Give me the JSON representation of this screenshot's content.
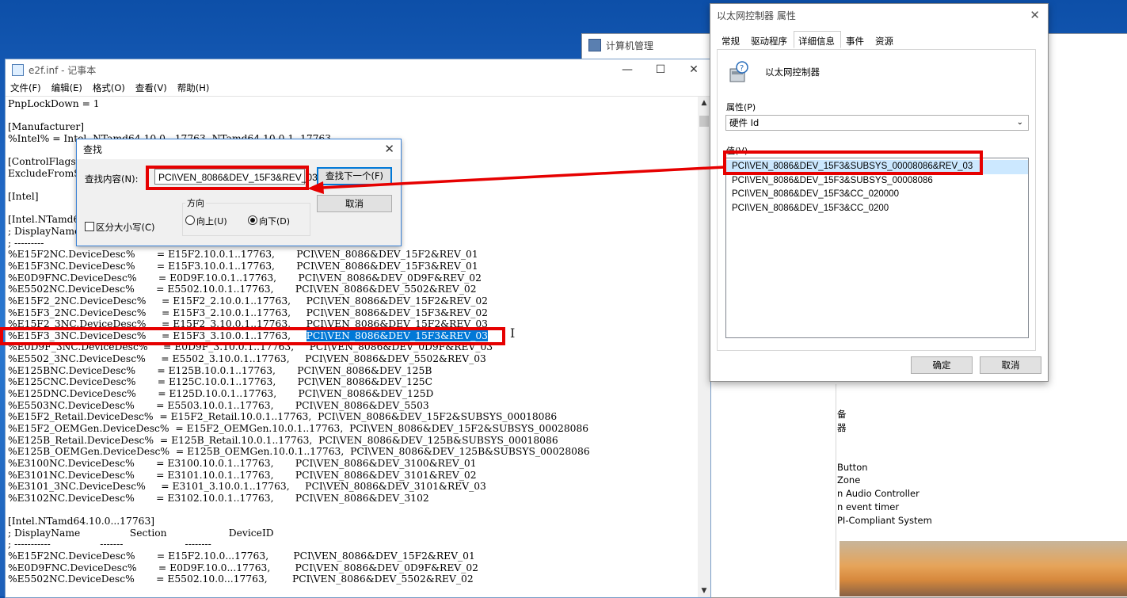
{
  "computer_management": {
    "title": "计算机管理",
    "tree_fragments": [
      "备",
      "器",
      "Button",
      "Zone",
      "n Audio Controller",
      "n event timer",
      "PI-Compliant System"
    ]
  },
  "notepad": {
    "title": "e2f.inf - 记事本",
    "window_controls": {
      "minimize": "—",
      "maximize": "☐",
      "close": "✕"
    },
    "menu": [
      "文件(F)",
      "编辑(E)",
      "格式(O)",
      "查看(V)",
      "帮助(H)"
    ],
    "lines": [
      "PnpLockDown = 1",
      "",
      "[Manufacturer]",
      "%Intel% = Intel, NTamd64.10.0...17763, NTamd64.10.0.1..17763",
      "",
      "[ControlFlags]",
      "ExcludeFromSelect = *",
      "",
      "[Intel]",
      "",
      "[Intel.NTamd64.10.0.1..17763]",
      "; DisplayName                Section                    DeviceID",
      "; ---------                  -------                    --------",
      "%E15F2NC.DeviceDesc%       = E15F2.10.0.1..17763,       PCI\\VEN_8086&DEV_15F2&REV_01",
      "%E15F3NC.DeviceDesc%       = E15F3.10.0.1..17763,       PCI\\VEN_8086&DEV_15F3&REV_01",
      "%E0D9FNC.DeviceDesc%       = E0D9F.10.0.1..17763,       PCI\\VEN_8086&DEV_0D9F&REV_02",
      "%E5502NC.DeviceDesc%       = E5502.10.0.1..17763,       PCI\\VEN_8086&DEV_5502&REV_02",
      "%E15F2_2NC.DeviceDesc%     = E15F2_2.10.0.1..17763,     PCI\\VEN_8086&DEV_15F2&REV_02",
      "%E15F3_2NC.DeviceDesc%     = E15F3_2.10.0.1..17763,     PCI\\VEN_8086&DEV_15F3&REV_02",
      "%E15F2_3NC.DeviceDesc%     = E15F2_3.10.0.1..17763,     PCI\\VEN_8086&DEV_15F2&REV_03",
      "%E15F3_3NC.DeviceDesc%     = E15F3_3.10.0.1..17763,     ",
      "%E0D9F_3NC.DeviceDesc%     = E0D9F_3.10.0.1..17763,     PCI\\VEN_8086&DEV_0D9F&REV_03",
      "%E5502_3NC.DeviceDesc%     = E5502_3.10.0.1..17763,     PCI\\VEN_8086&DEV_5502&REV_03",
      "%E125BNC.DeviceDesc%       = E125B.10.0.1..17763,       PCI\\VEN_8086&DEV_125B",
      "%E125CNC.DeviceDesc%       = E125C.10.0.1..17763,       PCI\\VEN_8086&DEV_125C",
      "%E125DNC.DeviceDesc%       = E125D.10.0.1..17763,       PCI\\VEN_8086&DEV_125D",
      "%E5503NC.DeviceDesc%       = E5503.10.0.1..17763,       PCI\\VEN_8086&DEV_5503",
      "%E15F2_Retail.DeviceDesc%  = E15F2_Retail.10.0.1..17763,  PCI\\VEN_8086&DEV_15F2&SUBSYS_00018086",
      "%E15F2_OEMGen.DeviceDesc%  = E15F2_OEMGen.10.0.1..17763,  PCI\\VEN_8086&DEV_15F2&SUBSYS_00028086",
      "%E125B_Retail.DeviceDesc%  = E125B_Retail.10.0.1..17763,  PCI\\VEN_8086&DEV_125B&SUBSYS_00018086",
      "%E125B_OEMGen.DeviceDesc%  = E125B_OEMGen.10.0.1..17763,  PCI\\VEN_8086&DEV_125B&SUBSYS_00028086",
      "%E3100NC.DeviceDesc%       = E3100.10.0.1..17763,       PCI\\VEN_8086&DEV_3100&REV_01",
      "%E3101NC.DeviceDesc%       = E3101.10.0.1..17763,       PCI\\VEN_8086&DEV_3101&REV_02",
      "%E3101_3NC.DeviceDesc%     = E3101_3.10.0.1..17763,     PCI\\VEN_8086&DEV_3101&REV_03",
      "%E3102NC.DeviceDesc%       = E3102.10.0.1..17763,       PCI\\VEN_8086&DEV_3102",
      "",
      "[Intel.NTamd64.10.0...17763]",
      "; DisplayName                Section                    DeviceID",
      "; -----------                -------                    --------",
      "%E15F2NC.DeviceDesc%       = E15F2.10.0...17763,        PCI\\VEN_8086&DEV_15F2&REV_01",
      "%E0D9FNC.DeviceDesc%       = E0D9F.10.0...17763,        PCI\\VEN_8086&DEV_0D9F&REV_02",
      "%E5502NC.DeviceDesc%       = E5502.10.0...17763,        PCI\\VEN_8086&DEV_5502&REV_02"
    ],
    "selected_match": "PCI\\VEN_8086&DEV_15F3&REV_03",
    "selected_line_index": 20,
    "scroll_up": "▲",
    "scroll_down": "▼"
  },
  "find_dialog": {
    "title": "查找",
    "close": "✕",
    "find_label": "查找内容(N):",
    "find_value": "PCI\\VEN_8086&DEV_15F3&REV_03",
    "find_next_button": "查找下一个(F)",
    "cancel_button": "取消",
    "direction_label": "方向",
    "up_label": "向上(U)",
    "down_label": "向下(D)",
    "direction_selected": "down",
    "match_case_label": "区分大小写(C)",
    "match_case_checked": false
  },
  "properties_dialog": {
    "title": "以太网控制器 属性",
    "close": "✕",
    "tabs": [
      "常规",
      "驱动程序",
      "详细信息",
      "事件",
      "资源"
    ],
    "active_tab": "详细信息",
    "device_name": "以太网控制器",
    "property_label": "属性(P)",
    "property_value": "硬件 Id",
    "value_label": "值(V)",
    "values": [
      "PCI\\VEN_8086&DEV_15F3&SUBSYS_00008086&REV_03",
      "PCI\\VEN_8086&DEV_15F3&SUBSYS_00008086",
      "PCI\\VEN_8086&DEV_15F3&CC_020000",
      "PCI\\VEN_8086&DEV_15F3&CC_0200"
    ],
    "ok_button": "确定",
    "cancel_button": "取消"
  },
  "colors": {
    "annotation_red": "#e60000",
    "selection_blue": "#0078d7",
    "list_selection": "#cce8ff"
  }
}
